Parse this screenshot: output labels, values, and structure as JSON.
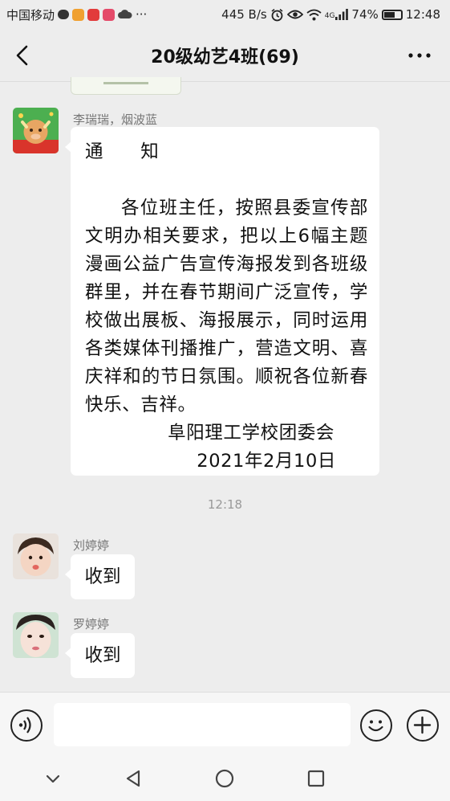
{
  "status_bar": {
    "carrier": "中国移动",
    "more": "···",
    "net_speed": "445 B/s",
    "network_type": "4G",
    "battery": "74%",
    "battery_level": 0.74,
    "time": "12:48",
    "icons": [
      "chat-icon",
      "app-icon",
      "app-icon",
      "app-icon",
      "cloud-icon",
      "alarm-icon",
      "eye-icon",
      "wifi-icon",
      "signal-icon",
      "battery-icon"
    ]
  },
  "header": {
    "title": "20级幼艺4班(69)",
    "back_icon": "chevron-left-icon",
    "more_icon": "more-dots-icon"
  },
  "messages": {
    "notice": {
      "sender": "李瑞瑞，烟波蓝",
      "title": "通　　知",
      "body": "各位班主任，按照县委宣传部文明办相关要求，把以上6幅主题漫画公益广告宣传海报发到各班级群里，并在春节期间广泛宣传，学校做出展板、海报展示，同时运用各类媒体刊播推广，营造文明、喜庆祥和的节日氛围。顺祝各位新春快乐、吉祥。",
      "signature": "阜阳理工学校团委会",
      "date": "2021年2月10日"
    },
    "timestamp": "12:18",
    "reply1": {
      "sender": "刘婷婷",
      "text": "收到"
    },
    "reply2": {
      "sender": "罗婷婷",
      "text": "收到"
    }
  },
  "input_bar": {
    "voice_icon": "voice-icon",
    "message_value": "",
    "emoji_icon": "emoji-icon",
    "plus_icon": "plus-icon"
  },
  "nav_bar": {
    "icons": [
      "chevron-down-icon",
      "back-triangle-icon",
      "home-circle-icon",
      "recents-square-icon"
    ]
  },
  "colors": {
    "background": "#ededed",
    "bubble": "#ffffff",
    "meta_text": "#777777",
    "text": "#111111"
  }
}
